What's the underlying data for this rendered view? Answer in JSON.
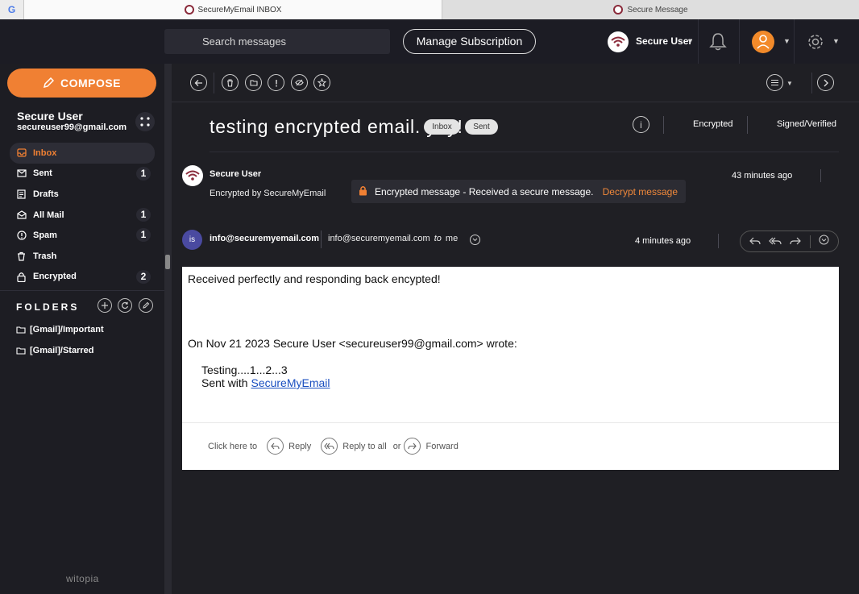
{
  "browser": {
    "tabs": [
      {
        "label": "SecureMyEmail INBOX",
        "active": true
      },
      {
        "label": "Secure Message",
        "active": false
      }
    ]
  },
  "header": {
    "search_placeholder": "Search messages",
    "manage_label": "Manage Subscription",
    "user_name": "Secure User"
  },
  "sidebar": {
    "compose_label": "COMPOSE",
    "account_name": "Secure User",
    "account_email": "secureuser99@gmail.com",
    "items": [
      {
        "label": "Inbox",
        "icon": "inbox-icon",
        "count": "",
        "active": true
      },
      {
        "label": "Sent",
        "icon": "envelope-icon",
        "count": "1"
      },
      {
        "label": "Drafts",
        "icon": "drafts-icon",
        "count": ""
      },
      {
        "label": "All Mail",
        "icon": "all-mail-icon",
        "count": "1"
      },
      {
        "label": "Spam",
        "icon": "spam-icon",
        "count": "1"
      },
      {
        "label": "Trash",
        "icon": "trash-icon",
        "count": ""
      },
      {
        "label": "Encrypted",
        "icon": "lock-icon",
        "count": "2"
      }
    ],
    "folders_title": "FOLDERS",
    "folders": [
      "[Gmail]/Important",
      "[Gmail]/Starred"
    ],
    "brand": "witopia"
  },
  "message": {
    "subject": "testing encrypted email. yay!",
    "labels": [
      "Inbox",
      "Sent"
    ],
    "status_encrypted": "Encrypted",
    "status_signed": "Signed/Verified",
    "first": {
      "sender": "Secure User",
      "encrypted_by": "Encrypted by SecureMyEmail",
      "banner_text": "Encrypted message - Received a secure message.",
      "decrypt_label": "Decrypt message",
      "time": "43 minutes ago"
    },
    "second": {
      "avatar_initials": "is",
      "from": "info@securemyemail.com",
      "to_addr": "info@securemyemail.com",
      "to_word": "to",
      "to_name": "me",
      "time": "4 minutes ago"
    },
    "body": {
      "text": "Received perfectly and responding back encypted!",
      "quote_header": "On Nov 21 2023 Secure User <secureuser99@gmail.com> wrote:",
      "quote_line1": "Testing....1...2...3",
      "quote_sent": "Sent with",
      "quote_link": "SecureMyEmail"
    },
    "reply_bar": {
      "prefix": "Click here to",
      "reply": "Reply",
      "reply_all": "Reply to all",
      "or": "or",
      "forward": "Forward"
    }
  },
  "colors": {
    "accent": "#f08033",
    "background": "#1f1f24",
    "link": "#1a4fc0"
  }
}
